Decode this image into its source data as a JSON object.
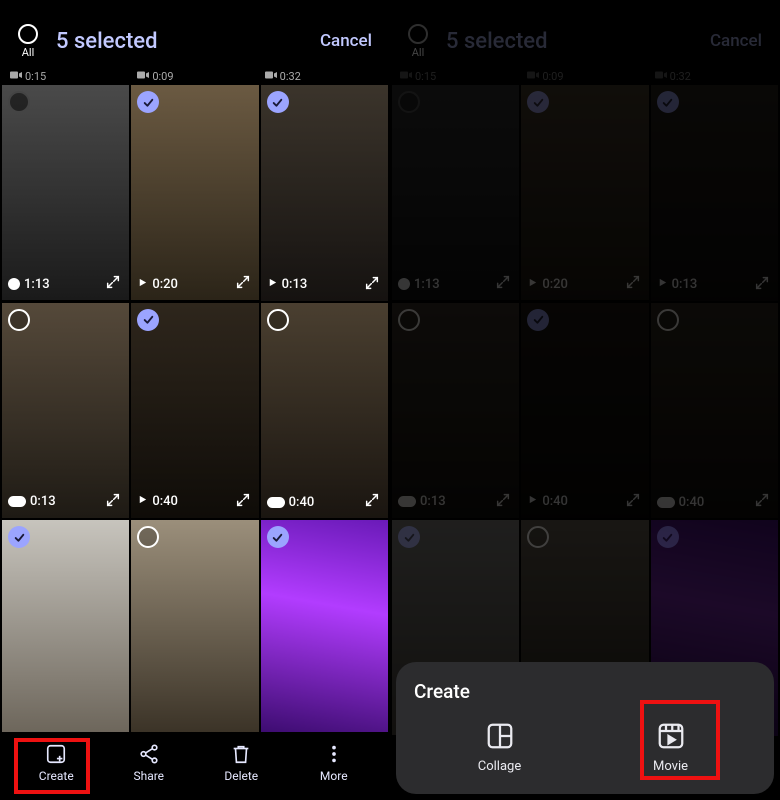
{
  "header": {
    "all_label": "All",
    "selected_text": "5 selected",
    "cancel_label": "Cancel"
  },
  "timestamps": [
    {
      "label": "0:15",
      "icon": "vid"
    },
    {
      "label": "0:09",
      "icon": "vid"
    },
    {
      "label": "0:32",
      "icon": "vid"
    }
  ],
  "tiles": [
    {
      "selected": false,
      "sel_style": "dark",
      "footer_type": "motion",
      "duration": "1:13",
      "photo": "p1"
    },
    {
      "selected": true,
      "sel_style": "checked",
      "footer_type": "play",
      "duration": "0:20",
      "photo": "p2"
    },
    {
      "selected": true,
      "sel_style": "checked",
      "footer_type": "play",
      "duration": "0:13",
      "photo": "p3"
    },
    {
      "selected": false,
      "sel_style": "empty",
      "footer_type": "pill",
      "duration": "0:13",
      "photo": "p4"
    },
    {
      "selected": true,
      "sel_style": "checked",
      "footer_type": "play",
      "duration": "0:40",
      "photo": "p5"
    },
    {
      "selected": false,
      "sel_style": "empty",
      "footer_type": "pill",
      "duration": "0:40",
      "photo": "p6"
    },
    {
      "selected": true,
      "sel_style": "checked",
      "footer_type": "none",
      "duration": "",
      "photo": "p7"
    },
    {
      "selected": false,
      "sel_style": "empty",
      "footer_type": "none",
      "duration": "",
      "photo": "p8"
    },
    {
      "selected": true,
      "sel_style": "checked",
      "footer_type": "none",
      "duration": "",
      "photo": "p9"
    }
  ],
  "bottom_bar": {
    "create": "Create",
    "share": "Share",
    "delete": "Delete",
    "more": "More"
  },
  "sheet": {
    "title": "Create",
    "collage": "Collage",
    "movie": "Movie"
  }
}
